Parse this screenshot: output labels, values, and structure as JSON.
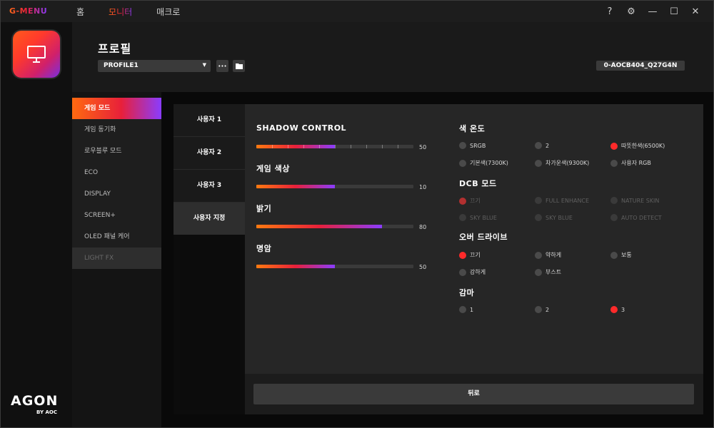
{
  "app": {
    "brand": "G-MENU"
  },
  "topnav": [
    {
      "label": "홈",
      "active": false
    },
    {
      "label": "모니터",
      "active": true
    },
    {
      "label": "매크로",
      "active": false
    }
  ],
  "window_controls": {
    "help": "?",
    "settings": "⚙",
    "minimize": "—",
    "maximize": "☐",
    "close": "✕"
  },
  "rail": {
    "logo_title": "AGON",
    "logo_sub": "BY AOC"
  },
  "header": {
    "title": "프로필",
    "profile_select": "PROFILE1",
    "more_label": "•••",
    "device_id": "0-AOCB404_Q27G4N"
  },
  "sidemenu": [
    {
      "label": "게임 모드",
      "state": "active"
    },
    {
      "label": "게임 동기화",
      "state": "normal"
    },
    {
      "label": "로우블루 모드",
      "state": "normal"
    },
    {
      "label": "ECO",
      "state": "normal"
    },
    {
      "label": "DISPLAY",
      "state": "normal"
    },
    {
      "label": "SCREEN+",
      "state": "normal"
    },
    {
      "label": "OLED 패널 케어",
      "state": "normal"
    },
    {
      "label": "LIGHT FX",
      "state": "disabled"
    }
  ],
  "user_tabs": [
    {
      "label": "사용자 1",
      "active": false
    },
    {
      "label": "사용자 2",
      "active": false
    },
    {
      "label": "사용자 3",
      "active": false
    },
    {
      "label": "사용자 지정",
      "active": true
    }
  ],
  "sliders": [
    {
      "label": "SHADOW CONTROL",
      "value": 50,
      "fraction": 0.5,
      "ticks": true
    },
    {
      "label": "게임 색상",
      "value": 10,
      "fraction": 0.5,
      "ticks": false
    },
    {
      "label": "밝기",
      "value": 80,
      "fraction": 0.8,
      "ticks": false
    },
    {
      "label": "명암",
      "value": 50,
      "fraction": 0.5,
      "ticks": false
    }
  ],
  "groups": {
    "color_temp": {
      "title": "색 온도",
      "options": [
        {
          "label": "SRGB",
          "selected": false,
          "disabled": false
        },
        {
          "label": "2",
          "selected": false,
          "disabled": false
        },
        {
          "label": "따뜻한색(6500K)",
          "selected": true,
          "disabled": false
        },
        {
          "label": "기본색(7300K)",
          "selected": false,
          "disabled": false
        },
        {
          "label": "차가운색(9300K)",
          "selected": false,
          "disabled": false
        },
        {
          "label": "사용자 RGB",
          "selected": false,
          "disabled": false
        }
      ]
    },
    "dcb": {
      "title": "DCB 모드",
      "options": [
        {
          "label": "끄기",
          "selected": true,
          "disabled": true
        },
        {
          "label": "FULL ENHANCE",
          "selected": false,
          "disabled": true
        },
        {
          "label": "NATURE SKIN",
          "selected": false,
          "disabled": true
        },
        {
          "label": "SKY BLUE",
          "selected": false,
          "disabled": true
        },
        {
          "label": "SKY BLUE",
          "selected": false,
          "disabled": true
        },
        {
          "label": "AUTO DETECT",
          "selected": false,
          "disabled": true
        }
      ]
    },
    "overdrive": {
      "title": "오버 드라이브",
      "options": [
        {
          "label": "끄기",
          "selected": true,
          "disabled": false
        },
        {
          "label": "약하게",
          "selected": false,
          "disabled": false
        },
        {
          "label": "보통",
          "selected": false,
          "disabled": false
        },
        {
          "label": "강하게",
          "selected": false,
          "disabled": false
        },
        {
          "label": "부스트",
          "selected": false,
          "disabled": false
        }
      ]
    },
    "gamma": {
      "title": "감마",
      "options": [
        {
          "label": "1",
          "selected": false,
          "disabled": false
        },
        {
          "label": "2",
          "selected": false,
          "disabled": false
        },
        {
          "label": "3",
          "selected": true,
          "disabled": false
        }
      ]
    }
  },
  "footer": {
    "back_label": "뒤로"
  }
}
